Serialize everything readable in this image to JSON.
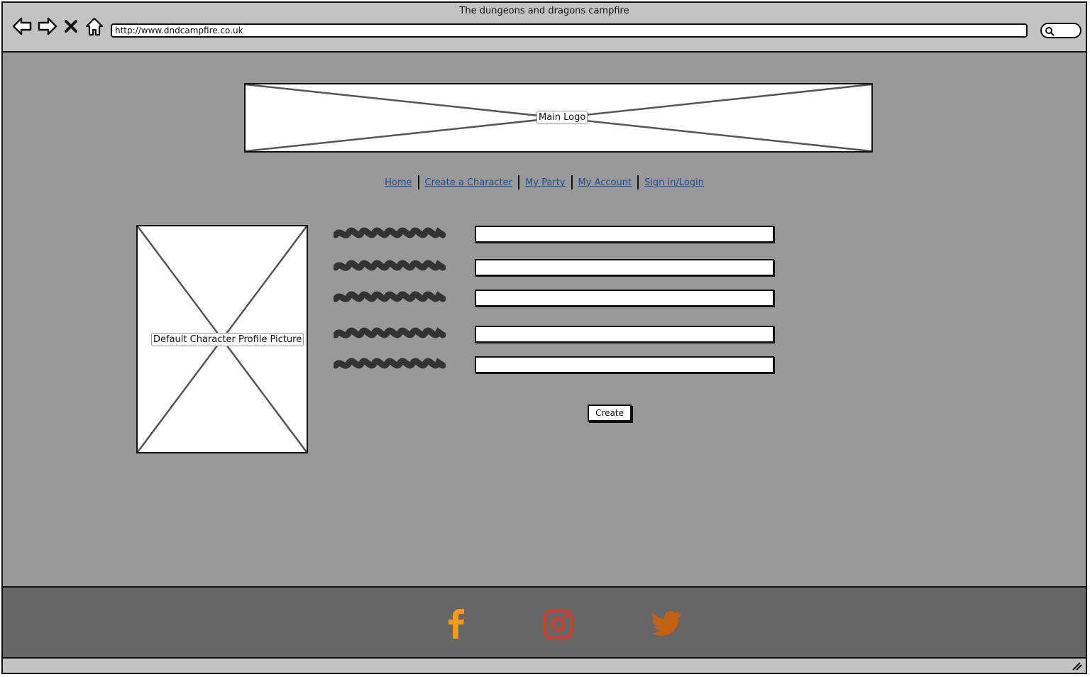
{
  "window": {
    "title": "The dungeons and dragons campfire",
    "url": "http://www.dndcampfire.co.uk"
  },
  "browser_controls": [
    "back-icon",
    "forward-icon",
    "stop-icon",
    "home-icon"
  ],
  "logo": {
    "label": "Main Logo"
  },
  "nav": {
    "items": [
      "Home",
      "Create a Character",
      "My Party",
      "My Account",
      "Sign in/Login"
    ]
  },
  "profile": {
    "label": "Default Character Profile Picture"
  },
  "form": {
    "rows": 5,
    "submit_label": "Create"
  },
  "footer": {
    "icons": [
      {
        "name": "facebook-icon",
        "color": "#f39c12"
      },
      {
        "name": "instagram-icon",
        "color": "#d63a2a"
      },
      {
        "name": "twitter-icon",
        "color": "#c0620f"
      }
    ]
  },
  "colors": {
    "page_bg": "#999999",
    "chrome": "#c3c3c3",
    "footer_bg": "#666666",
    "link": "#1b4f99"
  }
}
